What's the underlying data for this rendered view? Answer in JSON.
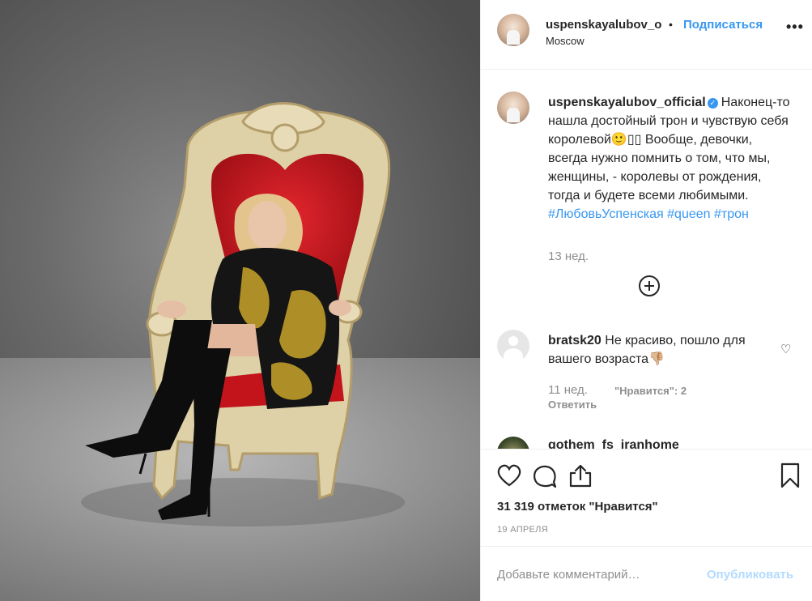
{
  "post": {
    "header": {
      "username": "uspenskayalubov_o",
      "separator": "•",
      "follow_label": "Подписаться",
      "location": "Moscow",
      "more_label": "•••"
    },
    "caption": {
      "username": "uspenskayalubov_official",
      "verified_mark": "✓",
      "text": "Наконец-то нашла достойный трон и чувствую себя королевой🙂▯▯ Вообще, девочки, всегда нужно помнить о том, что мы, женщины, - королевы от рождения, тогда и будете всеми любимыми.",
      "hashtags": [
        "#ЛюбовьУспенская",
        "#queen",
        "#трон"
      ],
      "time": "13 нед."
    },
    "comments": [
      {
        "username": "bratsk20",
        "text": "Не красиво, пошло для вашего возраста👎🏼",
        "time": "11 нед.",
        "likes_label": "\"Нравится\": 2",
        "reply_label": "Ответить"
      },
      {
        "username": "gothem_fs_iranhome"
      }
    ],
    "likes_count": "31 319 отметок \"Нравится\"",
    "date": "19 АПРЕЛЯ",
    "add_comment": {
      "placeholder": "Добавьте комментарий…",
      "publish_label": "Опубликовать"
    }
  },
  "colors": {
    "link": "#3897f0",
    "muted": "#8e8e8e",
    "text": "#262626",
    "publish_disabled": "#b3dbff"
  }
}
